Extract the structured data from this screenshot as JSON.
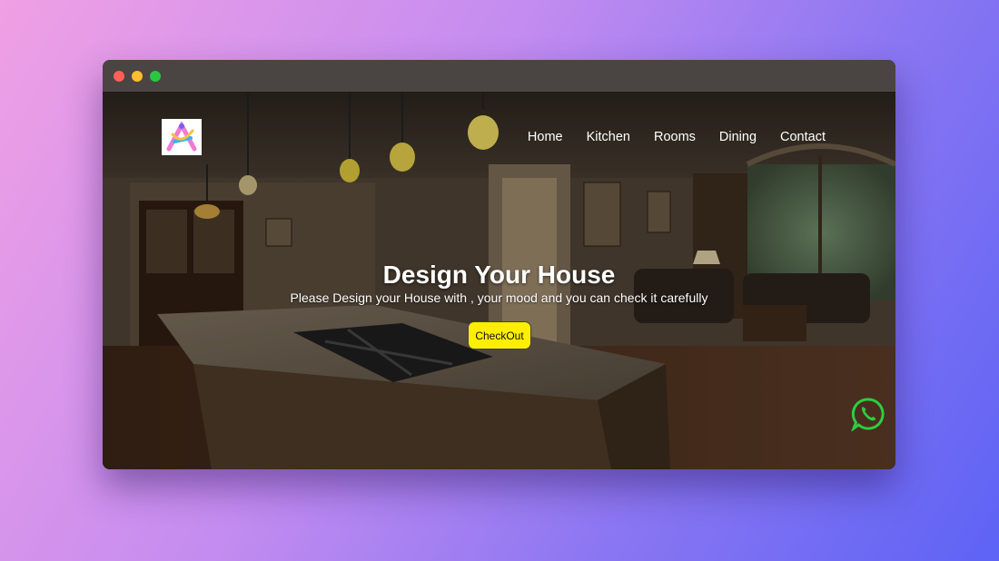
{
  "window": {
    "controls": [
      "close",
      "minimize",
      "maximize"
    ]
  },
  "site": {
    "logo_icon": "colorful-a-logo-icon",
    "nav": [
      {
        "label": "Home"
      },
      {
        "label": "Kitchen"
      },
      {
        "label": "Rooms"
      },
      {
        "label": "Dining"
      },
      {
        "label": "Contact"
      }
    ],
    "hero": {
      "title": "Design Your House",
      "subtitle": "Please Design your House with , your mood and you can check it carefully",
      "cta_label": "CheckOut",
      "cta_color": "#ffee00",
      "background": "dim-kitchen-living-room-photo"
    },
    "floating": {
      "icon": "whatsapp-icon",
      "color": "#2ecc40"
    }
  }
}
